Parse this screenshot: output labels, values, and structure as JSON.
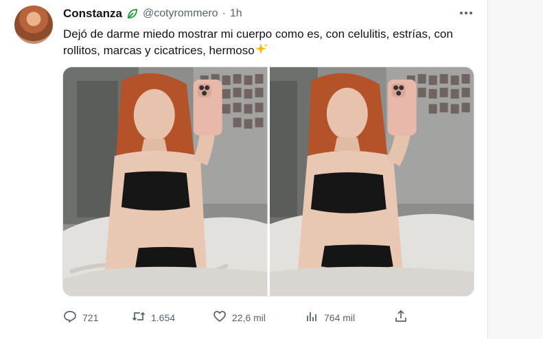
{
  "tweet": {
    "author_name": "Constanza",
    "author_handle": "@cotyrommero",
    "separator": "·",
    "time": "1h",
    "text": "Dejó de darme miedo mostrar mi cuerpo como es, con celulitis, estrías, con rollitos, marcas y cicatrices, hermoso",
    "emoji_icon": "sparkles-icon",
    "more_icon": "more-horizontal-icon",
    "badge_icon": "leaf-badge-icon"
  },
  "actions": {
    "replies": "721",
    "retweets": "1.654",
    "likes": "22,6 mil",
    "views": "764 mil"
  },
  "colors": {
    "text_primary": "#0f1419",
    "text_secondary": "#536471",
    "badge_green": "#2f9e44",
    "sparkle_yellow": "#f5b800"
  }
}
